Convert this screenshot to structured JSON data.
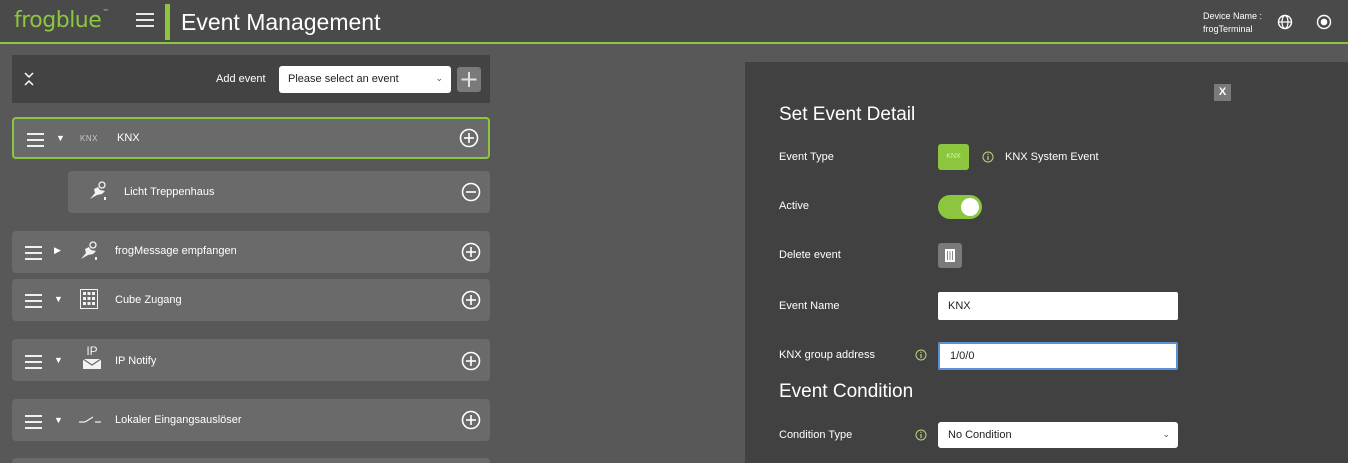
{
  "header": {
    "logo": "frogblue",
    "logo_tm": "™",
    "title": "Event Management",
    "device_label": "Device Name :",
    "device_name": "frogTerminal",
    "icons": [
      "menu-icon",
      "globe-icon",
      "radio-icon"
    ]
  },
  "toolbar": {
    "add_event_label": "Add event",
    "add_event_placeholder": "Please select an event"
  },
  "events": [
    {
      "label": "KNX",
      "tag": "KNX",
      "icon": "knx-text",
      "selected": true,
      "expanded": true
    },
    {
      "label": "Licht Treppenhaus",
      "icon": "frog-icon",
      "child": true
    },
    {
      "label": "frogMessage empfangen",
      "icon": "frog-icon",
      "expanded": false
    },
    {
      "label": "Cube Zugang",
      "icon": "keypad-icon",
      "expanded": true
    },
    {
      "label": "IP Notify",
      "icon": "ip-mail-icon",
      "ip_text": "IP",
      "expanded": true
    },
    {
      "label": "Lokaler Eingangsauslöser",
      "icon": "switch-icon",
      "expanded": true
    }
  ],
  "detail": {
    "close_label": "X",
    "title": "Set Event Detail",
    "event_type_label": "Event Type",
    "event_type_badge": "KNX",
    "event_type_value": "KNX System Event",
    "active_label": "Active",
    "active_on": true,
    "delete_label": "Delete event",
    "name_label": "Event Name",
    "name_value": "KNX",
    "group_address_label": "KNX group address",
    "group_address_value": "1/0/0",
    "condition_title": "Event Condition",
    "condition_type_label": "Condition Type",
    "condition_type_value": "No Condition"
  },
  "colors": {
    "accent": "#8cc63f",
    "header_bg": "#4a4a4a",
    "page_bg": "#585858",
    "row_bg": "#6a6a6a",
    "panel_bg": "#414141",
    "focus": "#5b8fd6"
  }
}
